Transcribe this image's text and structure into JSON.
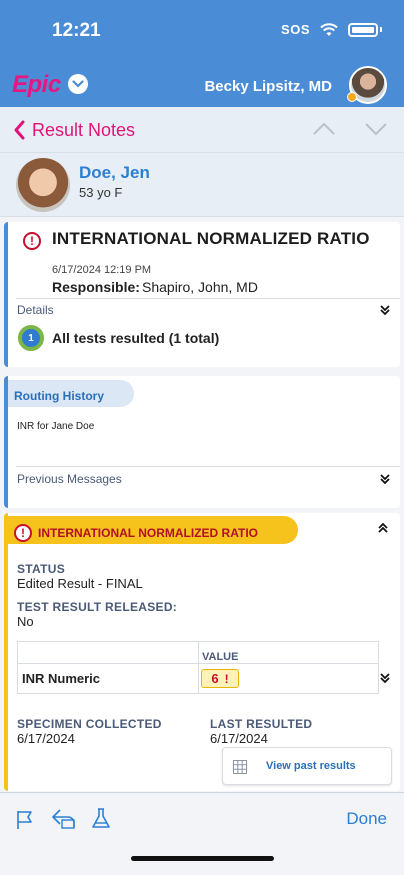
{
  "status_bar": {
    "time": "12:21",
    "sos": "SOS"
  },
  "header": {
    "logo": "Epic",
    "user_name": "Becky Lipsitz, MD"
  },
  "nav": {
    "title": "Result Notes"
  },
  "patient": {
    "name": "Doe, Jen",
    "age_sex": "53 yo F"
  },
  "result_card": {
    "title": "INTERNATIONAL NORMALIZED RATIO",
    "datetime": "6/17/2024 12:19 PM",
    "responsible_label": "Responsible:",
    "responsible_value": "Shapiro, John, MD",
    "details_label": "Details",
    "tests_count": "1",
    "tests_text": "All tests resulted (1 total)"
  },
  "routing_card": {
    "title": "Routing History",
    "body": "INR for Jane Doe",
    "previous_messages_label": "Previous Messages"
  },
  "component_card": {
    "title": "INTERNATIONAL NORMALIZED RATIO",
    "status_label": "STATUS",
    "status_value": "Edited Result - FINAL",
    "released_label": "TEST RESULT RELEASED:",
    "released_value": "No",
    "table": {
      "value_header": "VALUE",
      "row_label": "INR Numeric",
      "row_value": "6",
      "row_flag": "!"
    },
    "specimen_label": "SPECIMEN COLLECTED",
    "specimen_value": "6/17/2024",
    "last_resulted_label": "LAST RESULTED",
    "last_resulted_value": "6/17/2024",
    "past_results_button": "View past results"
  },
  "bottom_bar": {
    "done_label": "Done"
  },
  "colors": {
    "header_blue": "#4a8dd6",
    "accent_pink": "#e01478",
    "link_blue": "#2b7fd4",
    "alert_yellow": "#f6c21c",
    "alert_red": "#c8102e"
  }
}
